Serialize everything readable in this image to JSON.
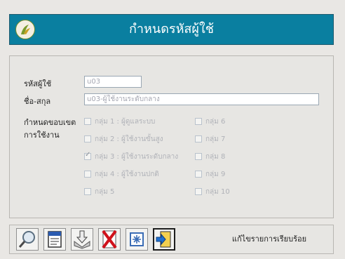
{
  "header": {
    "title": "กำหนดรหัสผู้ใช้"
  },
  "form": {
    "user_id_label": "รหัสผู้ใช้",
    "user_id_value": "u03",
    "fullname_label": "ชื่อ-สกุล",
    "fullname_value": "u03-ผู้ใช้งานระดับกลาง",
    "scope_label_1": "กำหนดขอบเขต",
    "scope_label_2": "การใช้งาน"
  },
  "groups": [
    {
      "label": "กลุ่ม 1 : ผู้ดูแลระบบ",
      "checked": false
    },
    {
      "label": "กลุ่ม 2 : ผู้ใช้งานขั้นสูง",
      "checked": false
    },
    {
      "label": "กลุ่ม 3 : ผู้ใช้งานระดับกลาง",
      "checked": true
    },
    {
      "label": "กลุ่ม 4 : ผู้ใช้งานปกติ",
      "checked": false
    },
    {
      "label": "กลุ่ม 5",
      "checked": false
    },
    {
      "label": "กลุ่ม 6",
      "checked": false
    },
    {
      "label": "กลุ่ม 7",
      "checked": false
    },
    {
      "label": "กลุ่ม 8",
      "checked": false
    },
    {
      "label": "กลุ่ม 9",
      "checked": false
    },
    {
      "label": "กลุ่ม 10",
      "checked": false
    }
  ],
  "toolbar": {
    "status": "แก้ไขรายการเรียบร้อย",
    "buttons": [
      "search-icon",
      "edit-document-icon",
      "download-icon",
      "delete-icon",
      "refresh-icon",
      "exit-icon"
    ]
  },
  "colors": {
    "header": "#0a7fa0",
    "background": "#e9e7e4"
  }
}
